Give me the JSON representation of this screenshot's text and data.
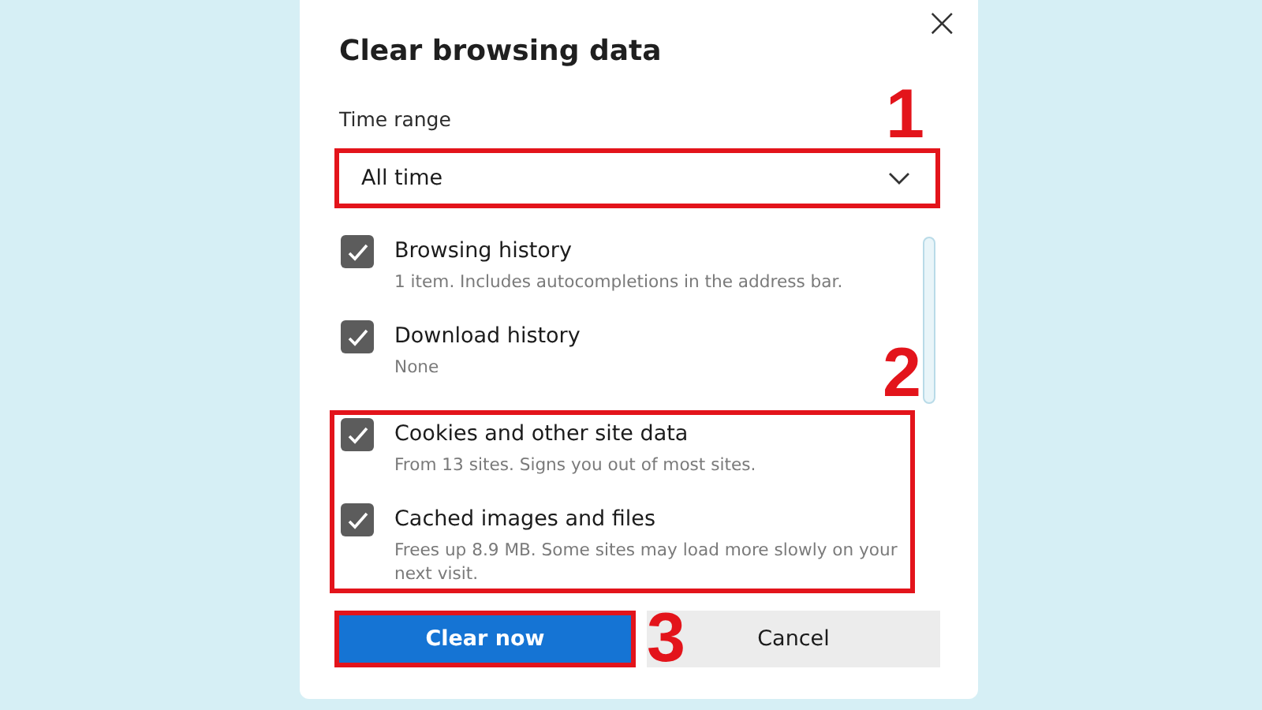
{
  "dialog": {
    "title": "Clear browsing data",
    "close_icon": "×"
  },
  "time_range": {
    "label": "Time range",
    "value": "All time",
    "highlighted": true,
    "badge": "1"
  },
  "groups": [
    {
      "highlighted": false,
      "items": [
        {
          "title": "Browsing history",
          "description": "1 item. Includes autocompletions in the address bar.",
          "checked": true
        },
        {
          "title": "Download history",
          "description": "None",
          "checked": true
        }
      ]
    },
    {
      "highlighted": true,
      "badge": "2",
      "items": [
        {
          "title": "Cookies and other site data",
          "description": "From 13 sites. Signs you out of most sites.",
          "checked": true
        },
        {
          "title": "Cached images and files",
          "description": "Frees up 8.9 MB. Some sites may load more slowly on your next visit.",
          "checked": true
        }
      ]
    }
  ],
  "buttons": [
    {
      "label": "Clear now",
      "kind": "primary",
      "highlighted": true,
      "badge": "3"
    },
    {
      "label": "Cancel",
      "kind": "secondary",
      "highlighted": false
    }
  ]
}
